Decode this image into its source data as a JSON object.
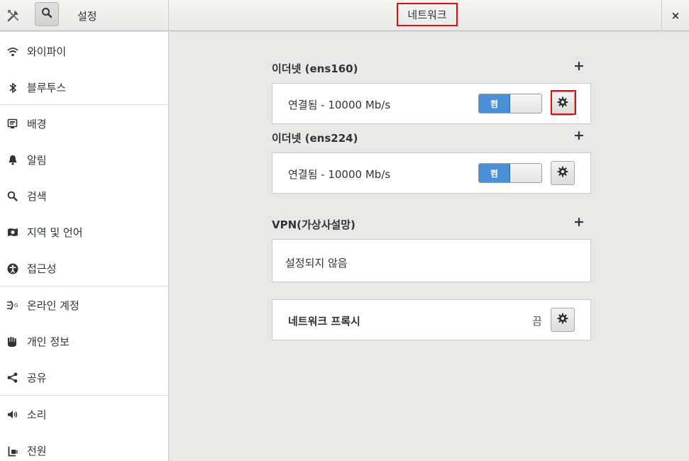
{
  "header": {
    "app_title": "설정",
    "page_title": "네트워크",
    "close": "×"
  },
  "sidebar": {
    "items": [
      {
        "label": "와이파이",
        "icon": "wifi-icon"
      },
      {
        "label": "블루투스",
        "icon": "bluetooth-icon"
      },
      {
        "label": "배경",
        "icon": "background-icon"
      },
      {
        "label": "알림",
        "icon": "bell-icon"
      },
      {
        "label": "검색",
        "icon": "search-icon"
      },
      {
        "label": "지역 및 언어",
        "icon": "region-icon"
      },
      {
        "label": "접근성",
        "icon": "accessibility-icon"
      },
      {
        "label": "온라인 계정",
        "icon": "online-accounts-icon"
      },
      {
        "label": "개인 정보",
        "icon": "privacy-hand-icon"
      },
      {
        "label": "공유",
        "icon": "share-icon"
      },
      {
        "label": "소리",
        "icon": "speaker-icon"
      },
      {
        "label": "전원",
        "icon": "power-icon"
      }
    ]
  },
  "main": {
    "ethernet1": {
      "title": "이더넷 (ens160)",
      "status": "연결됨 - 10000 Mb/s",
      "toggle": "켬"
    },
    "ethernet2": {
      "title": "이더넷 (ens224)",
      "status": "연결됨 - 10000 Mb/s",
      "toggle": "켬"
    },
    "vpn": {
      "title": "VPN(가상사설망)",
      "status": "설정되지 않음"
    },
    "proxy": {
      "title": "네트워크 프록시",
      "value": "끔"
    },
    "add_symbol": "+"
  },
  "colors": {
    "accent": "#4a90d9",
    "highlight": "#dc1010"
  }
}
